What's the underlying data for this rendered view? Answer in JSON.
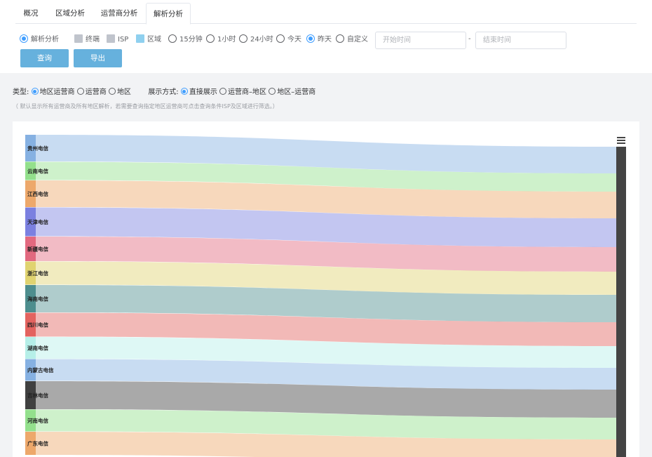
{
  "tabs": [
    {
      "label": "概况",
      "active": false
    },
    {
      "label": "区域分析",
      "active": false
    },
    {
      "label": "运营商分析",
      "active": false
    },
    {
      "label": "解析分析",
      "active": true
    }
  ],
  "filters": {
    "mode_label": "解析分析",
    "terminal_label": "终端",
    "isp_label": "ISP",
    "region_label": "区域",
    "range_15m": "15分钟",
    "range_1h": "1小时",
    "range_24h": "24小时",
    "range_today": "今天",
    "range_yesterday": "昨天",
    "range_custom": "自定义",
    "selected_range": "昨天",
    "start_placeholder": "开始时间",
    "end_placeholder": "结束时间",
    "separator": "-"
  },
  "actions": {
    "query": "查询",
    "export": "导出"
  },
  "options": {
    "type_label": "类型:",
    "type_region_isp": "地区运营商",
    "type_isp": "运营商",
    "type_region": "地区",
    "display_label": "展示方式:",
    "display_direct": "直接展示",
    "display_isp_region": "运营商–地区",
    "display_region_isp": "地区–运营商"
  },
  "hint": "（ 默认显示所有运营商及所有地区解析，若需要查询指定地区运营商可点击查询条件ISP及区域进行筛选。）",
  "colors": {
    "accent": "#409eff",
    "button": "#66b1dd",
    "terminal_swatch": "#c0c4cc",
    "region_swatch": "#8fd0ef",
    "target_node": "#444444"
  },
  "chart_data": {
    "type": "sankey",
    "nodes": [
      {
        "name": "贵州电信",
        "color": "#86b1e2"
      },
      {
        "name": "云南电信",
        "color": "#93e08c"
      },
      {
        "name": "江西电信",
        "color": "#eda86b"
      },
      {
        "name": "天津电信",
        "color": "#7b80e0"
      },
      {
        "name": "新疆电信",
        "color": "#e2697f"
      },
      {
        "name": "浙江电信",
        "color": "#e0d370"
      },
      {
        "name": "海南电信",
        "color": "#4e8e8e"
      },
      {
        "name": "四川电信",
        "color": "#e3635f"
      },
      {
        "name": "湖南电信",
        "color": "#b6efe8"
      },
      {
        "name": "内蒙古电信",
        "color": "#86b1e2"
      },
      {
        "name": "吉林电信",
        "color": "#404040"
      },
      {
        "name": "河南电信",
        "color": "#93e08c"
      },
      {
        "name": "广东电信",
        "color": "#eda86b"
      }
    ],
    "values": [
      38,
      26,
      38,
      41,
      35,
      33,
      39,
      34,
      31,
      31,
      40,
      31,
      33
    ]
  }
}
